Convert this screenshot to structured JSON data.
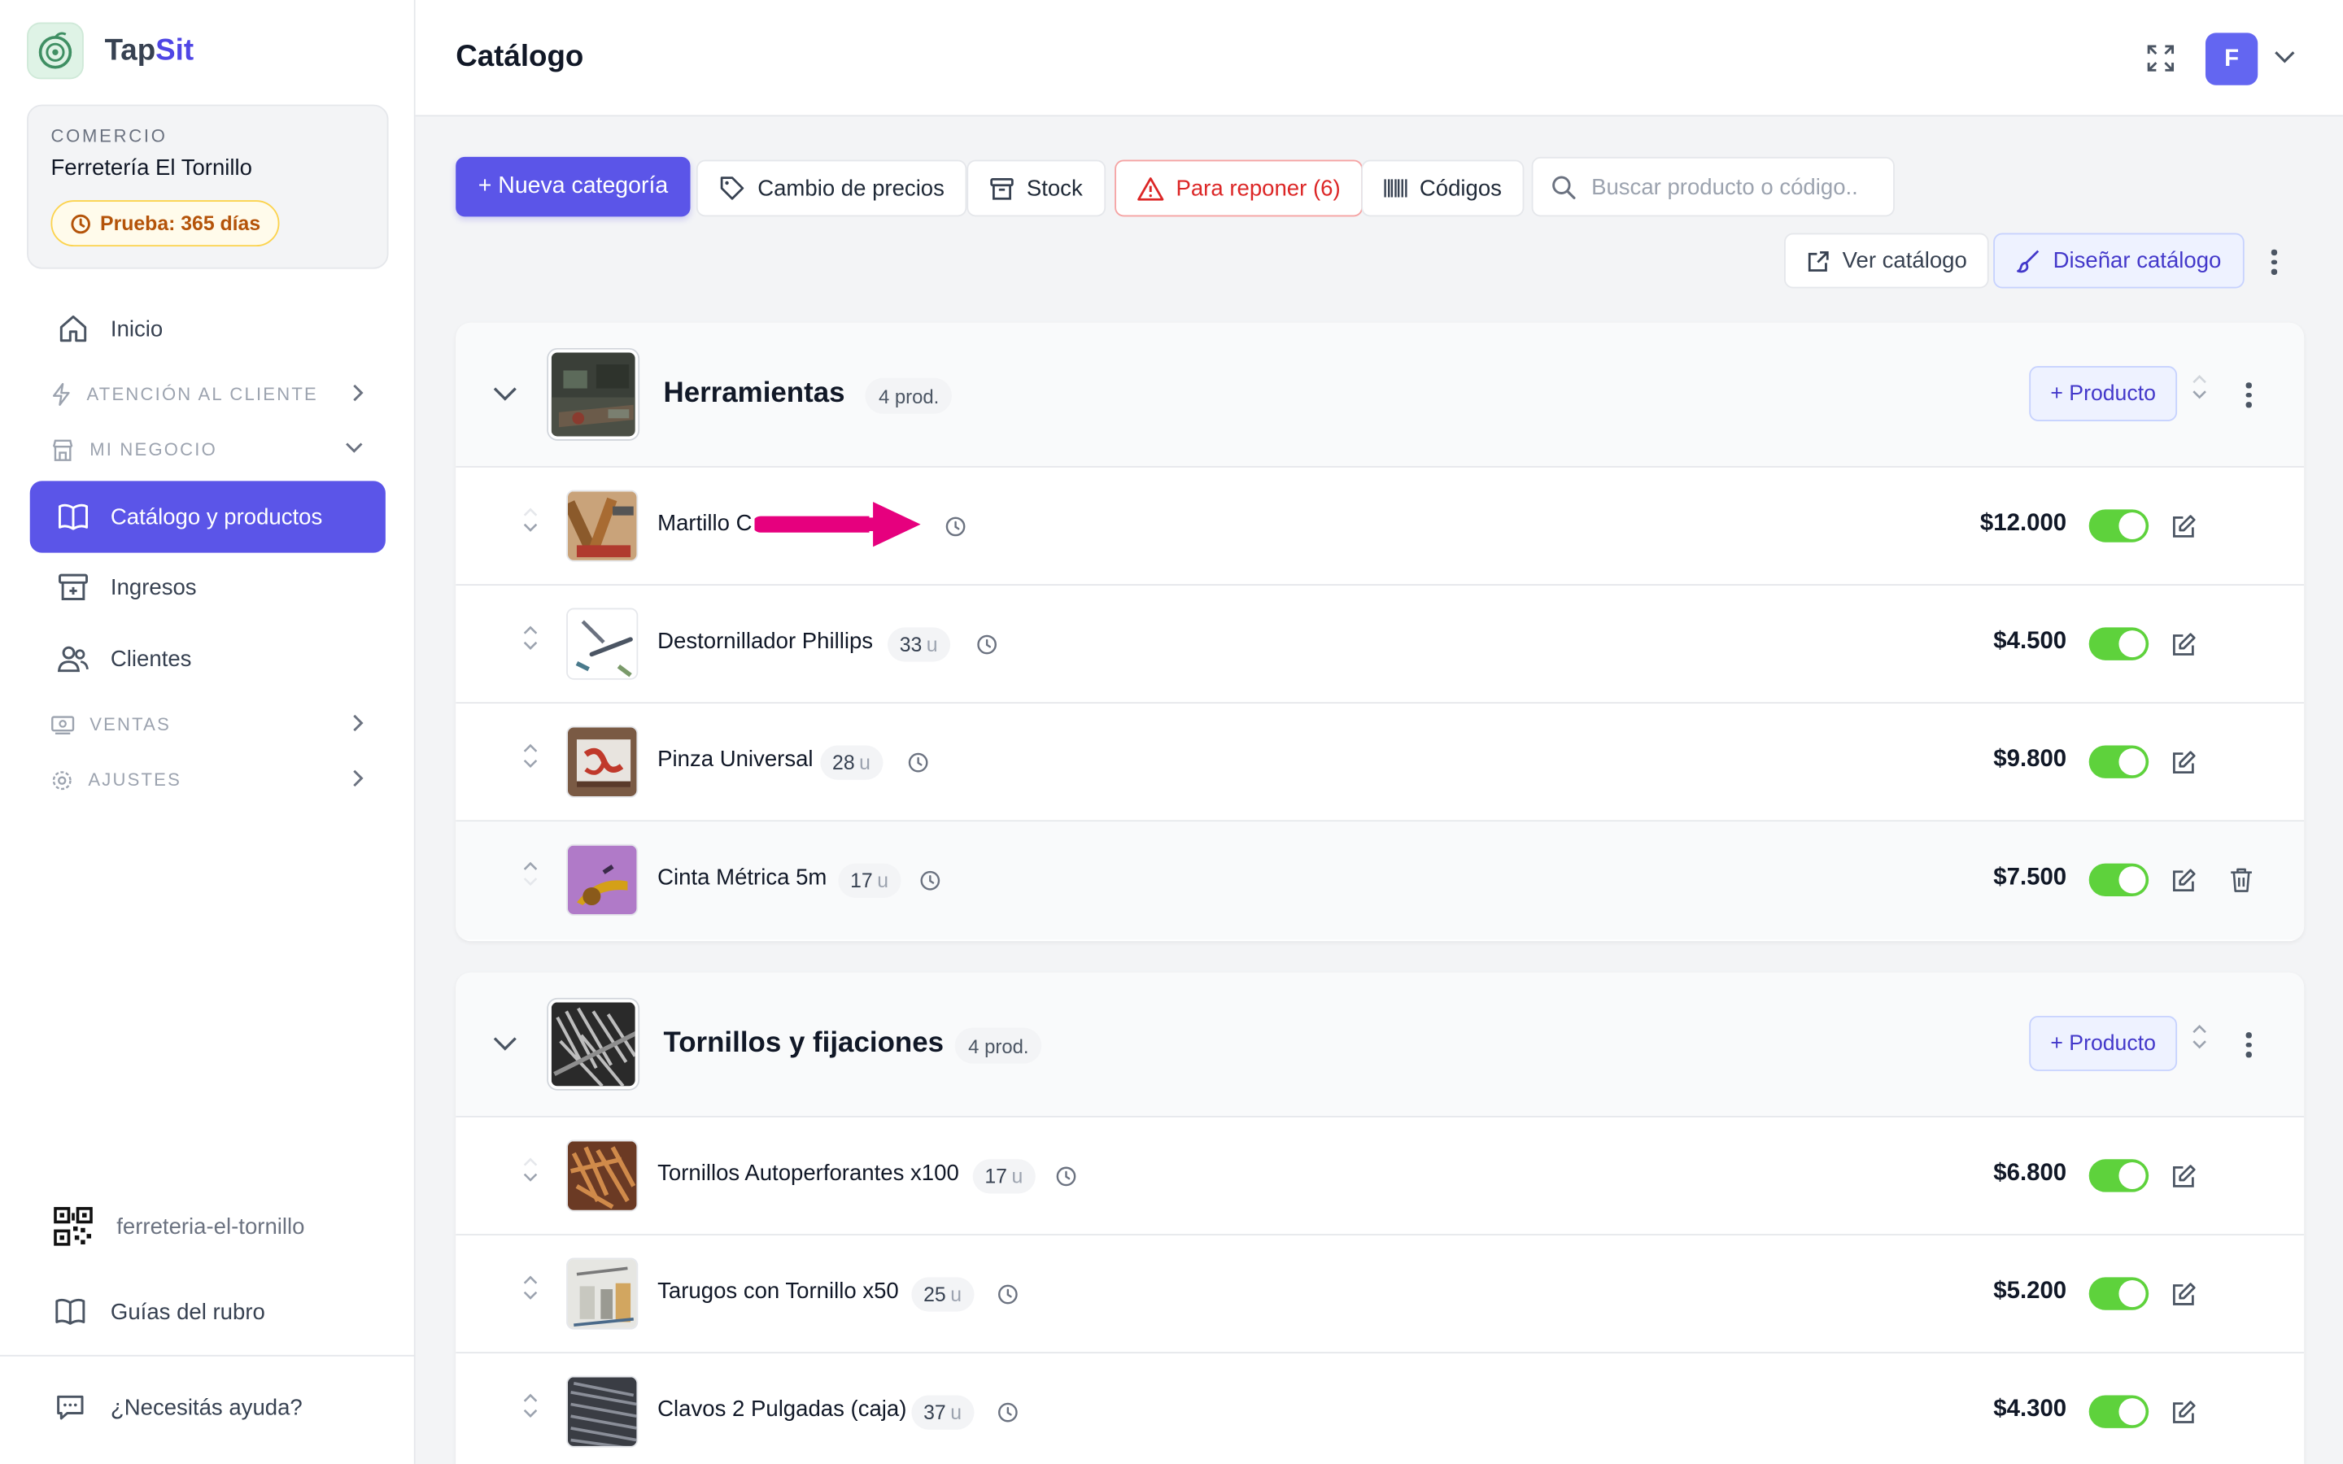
{
  "brand": {
    "name_prefix": "Tap",
    "name_accent": "Sit"
  },
  "shop": {
    "eyebrow": "COMERCIO",
    "name": "Ferretería El Tornillo",
    "trial": "Prueba: 365 días"
  },
  "nav": {
    "inicio": "Inicio",
    "atencion": "ATENCIÓN AL CLIENTE",
    "negocio": "MI NEGOCIO",
    "catalogo": "Catálogo y productos",
    "ingresos": "Ingresos",
    "clientes": "Clientes",
    "ventas": "VENTAS",
    "ajustes": "AJUSTES"
  },
  "sidebar_bottom": {
    "slug": "ferreteria-el-tornillo",
    "guides": "Guías del rubro",
    "help": "¿Necesitás ayuda?"
  },
  "header": {
    "title": "Catálogo",
    "avatar_initial": "F"
  },
  "toolbar": {
    "new_category": "+ Nueva categoría",
    "price_change": "Cambio de precios",
    "stock": "Stock",
    "restock": "Para reponer (6)",
    "codes": "Códigos",
    "search_placeholder": "Buscar producto o código..",
    "view_catalog": "Ver catálogo",
    "design_catalog": "Diseñar catálogo"
  },
  "categories": [
    {
      "name": "Herramientas",
      "count": "4 prod.",
      "add_label": "+ Producto",
      "products": [
        {
          "name": "Martillo C",
          "stock": "",
          "price": "$12.000"
        },
        {
          "name": "Destornillador Phillips",
          "stock": "33",
          "price": "$4.500"
        },
        {
          "name": "Pinza Universal",
          "stock": "28",
          "price": "$9.800"
        },
        {
          "name": "Cinta Métrica 5m",
          "stock": "17",
          "price": "$7.500"
        }
      ]
    },
    {
      "name": "Tornillos y fijaciones",
      "count": "4 prod.",
      "add_label": "+ Producto",
      "products": [
        {
          "name": "Tornillos Autoperforantes x100",
          "stock": "17",
          "price": "$6.800"
        },
        {
          "name": "Tarugos con Tornillo x50",
          "stock": "25",
          "price": "$5.200"
        },
        {
          "name": "Clavos 2 Pulgadas (caja)",
          "stock": "37",
          "price": "$4.300"
        }
      ]
    }
  ],
  "unit_label": "u",
  "colors": {
    "accent": "#5b55e8",
    "toggle_on": "#5ed23c",
    "danger": "#dc2626",
    "trial": "#b45309",
    "annotation_arrow": "#e6007e"
  }
}
